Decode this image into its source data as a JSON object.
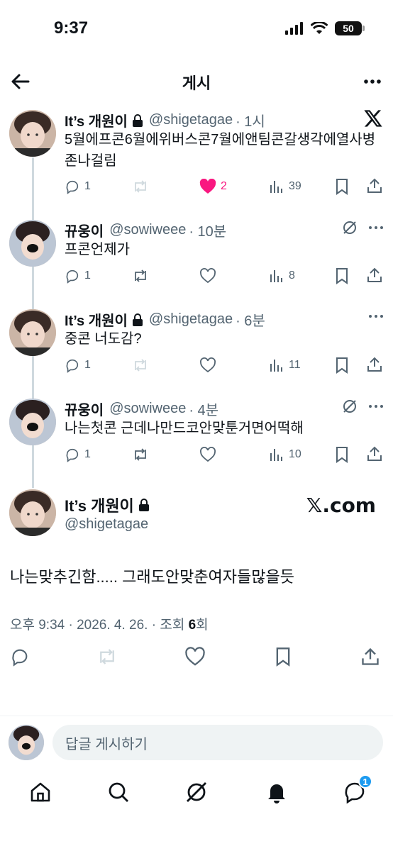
{
  "status": {
    "time": "9:37",
    "battery": "50"
  },
  "nav": {
    "title": "게시"
  },
  "tweets": [
    {
      "name": "It’s 개원이",
      "locked": true,
      "handle": "@shigetagae",
      "time": "· 1시",
      "text": "5월에프콘6월에위버스콘7월에앤팀콘갈생각에열사병존나걸림",
      "replies": "1",
      "likes": "2",
      "views": "39",
      "liked": true
    },
    {
      "name": "뀨웅이",
      "handle": "@sowiweee",
      "time": "· 10분",
      "text": "프콘언제가",
      "replies": "1",
      "likes": "",
      "views": "8"
    },
    {
      "name": "It’s 개원이",
      "locked": true,
      "handle": "@shigetagae",
      "time": "· 6분",
      "text": "중콘 너도감?",
      "replies": "1",
      "likes": "",
      "views": "11"
    },
    {
      "name": "뀨웅이",
      "handle": "@sowiweee",
      "time": "· 4분",
      "text": "나는첫콘 근데나만드코안맞툰거면어떡해",
      "replies": "1",
      "likes": "",
      "views": "10"
    }
  ],
  "main": {
    "name": "It’s 개원이",
    "handle": "@shigetagae",
    "brand": "𝕏.com",
    "text": "나는맞추긴함..... 그래도안맞춘여자들많을듯",
    "meta_prefix": "오후 9:34 · 2026. 4. 26. · 조회 ",
    "views": "6",
    "meta_suffix": "회"
  },
  "reply": {
    "placeholder": "답글 게시하기"
  },
  "tabbar": {
    "badge": "1"
  },
  "colors": {
    "like": "#f91880",
    "accent": "#1d9bf0",
    "muted": "#536471"
  }
}
